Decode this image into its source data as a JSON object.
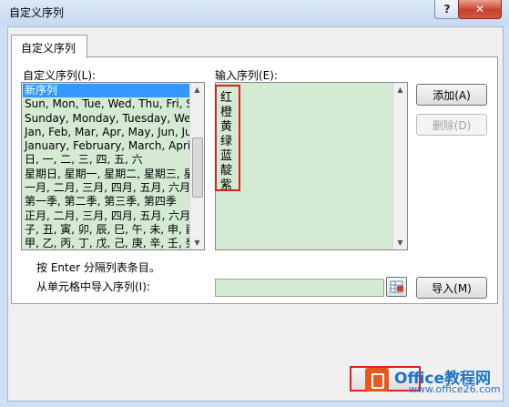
{
  "window": {
    "title": "自定义序列",
    "help_glyph": "?",
    "close_glyph": "✕"
  },
  "tab": {
    "label": "自定义序列"
  },
  "custom_lists": {
    "label": "自定义序列(L):",
    "items": [
      "新序列",
      "Sun, Mon, Tue, Wed, Thu, Fri, Sat",
      "Sunday, Monday, Tuesday, Wednesday",
      "Jan, Feb, Mar, Apr, May, Jun, Jul",
      "January, February, March, April",
      "日, 一, 二, 三, 四, 五, 六",
      "星期日, 星期一, 星期二, 星期三, 星期四",
      "一月, 二月, 三月, 四月, 五月, 六月, 七月",
      "第一季, 第二季, 第三季, 第四季",
      "正月, 二月, 三月, 四月, 五月, 六月, 七月",
      "子, 丑, 寅, 卯, 辰, 巳, 午, 未, 申, 酉",
      "甲, 乙, 丙, 丁, 戊, 己, 庚, 辛, 壬, 癸"
    ],
    "selected_index": 0
  },
  "input_list": {
    "label": "输入序列(E):",
    "entries": [
      "红",
      "橙",
      "黄",
      "绿",
      "蓝",
      "靛",
      "紫"
    ]
  },
  "buttons": {
    "add": "添加(A)",
    "delete": "删除(D)",
    "import": "导入(M)"
  },
  "hint": "按 Enter 分隔列表条目。",
  "import_label": "从单元格中导入序列(I):",
  "import_value": "",
  "watermark": {
    "brand": "Office教程网",
    "url": "www.office26.com"
  }
}
